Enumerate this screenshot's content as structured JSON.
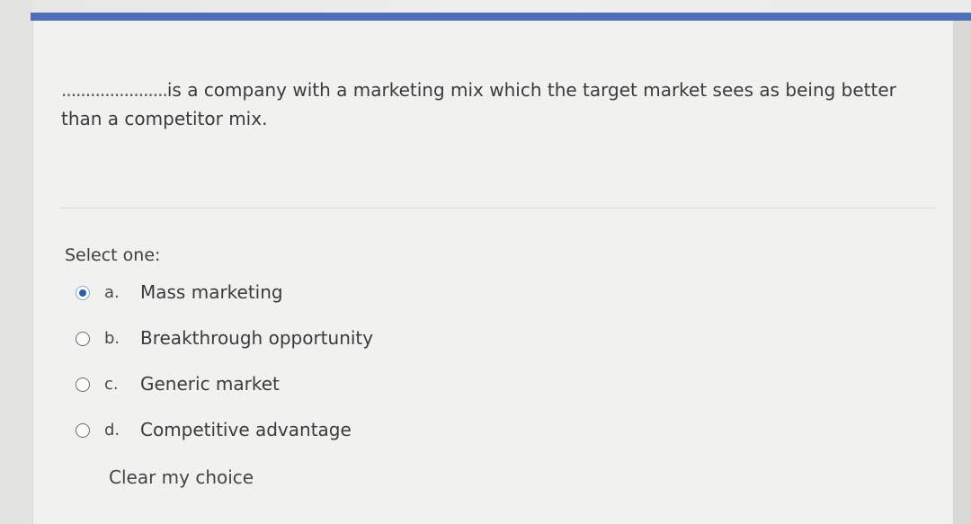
{
  "question": {
    "blank": "......................",
    "text": "is a company with a marketing mix which the target market sees as being better than a competitor mix."
  },
  "prompt": "Select one:",
  "options": [
    {
      "letter": "a.",
      "label": "Mass marketing",
      "selected": true
    },
    {
      "letter": "b.",
      "label": "Breakthrough opportunity",
      "selected": false
    },
    {
      "letter": "c.",
      "label": "Generic market",
      "selected": false
    },
    {
      "letter": "d.",
      "label": "Competitive advantage",
      "selected": false
    }
  ],
  "clear_label": "Clear my choice",
  "colors": {
    "accent": "#4f6fb8",
    "radio_selected": "#2f5ea8"
  }
}
